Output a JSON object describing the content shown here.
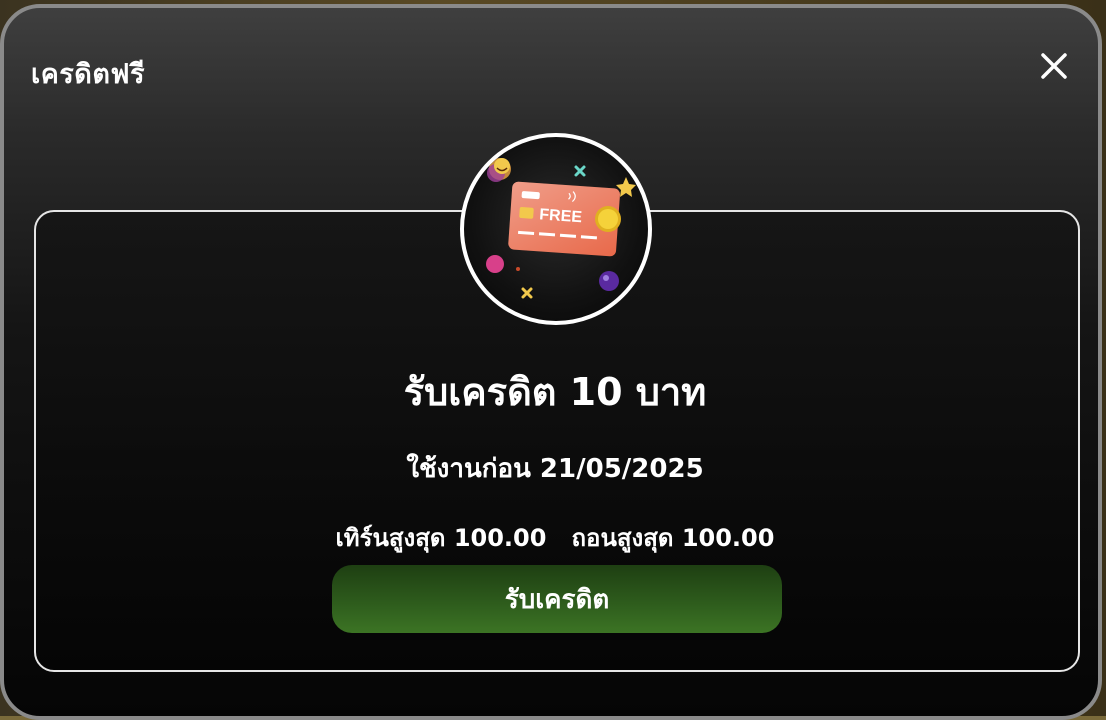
{
  "modal": {
    "title": "เครดิตฟรี",
    "close_icon": "close-icon"
  },
  "badge": {
    "card_text": "FREE",
    "icons": [
      "credit-card-icon",
      "coin-icon",
      "smiley-emoji-icon",
      "star-icon",
      "sparkle-x-icon",
      "ball-icon"
    ]
  },
  "offer": {
    "heading": "รับเครดิต 10 บาท",
    "expiry": "ใช้งานก่อน 21/05/2025",
    "max_turnover": "เทิร์นสูงสุด 100.00",
    "max_withdraw": "ถอนสูงสุด 100.00",
    "claim_label": "รับเครดิต"
  },
  "colors": {
    "claim_button": "#2f5e1d",
    "card_orange": "#e8694a",
    "border": "#ffffff"
  }
}
